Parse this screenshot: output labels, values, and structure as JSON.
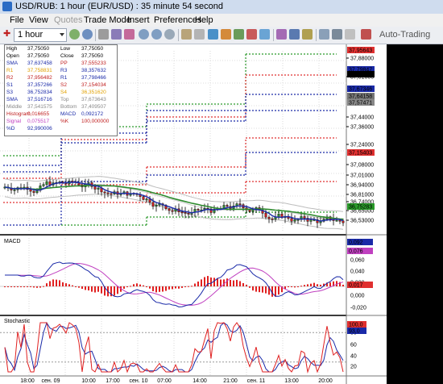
{
  "window": {
    "title": "USD/RUB: 1 hour (EUR/USD) : 35 minute 54 second"
  },
  "menu": [
    {
      "label": "File",
      "disabled": false
    },
    {
      "label": "View",
      "disabled": false
    },
    {
      "label": "Quotes",
      "disabled": true
    },
    {
      "label": "Trade Mode",
      "disabled": false
    },
    {
      "label": "Insert",
      "disabled": false
    },
    {
      "label": "Preferences",
      "disabled": false
    },
    {
      "label": "Help",
      "disabled": false
    }
  ],
  "toolbar": {
    "timeframe": "1 hour",
    "auto_trading": "Auto-Trading"
  },
  "info": {
    "rows": [
      [
        {
          "k": "High",
          "v": "37,75050",
          "c": "#000"
        },
        {
          "k": "Low",
          "v": "37,75050",
          "c": "#000"
        }
      ],
      [
        {
          "k": "Open",
          "v": "37,75050",
          "c": "#000"
        },
        {
          "k": "Close",
          "v": "37,75050",
          "c": "#000"
        }
      ],
      [
        {
          "k": "SMA",
          "v": "37,637458",
          "c": "#1a2aa8"
        },
        {
          "k": "PP",
          "v": "37,555233",
          "c": "#c02020"
        }
      ],
      [
        {
          "k": "R1",
          "v": "37,758831",
          "c": "#e0a000"
        },
        {
          "k": "R3",
          "v": "38,357632",
          "c": "#1a2aa8"
        }
      ],
      [
        {
          "k": "R2",
          "v": "37,956482",
          "c": "#c02020"
        },
        {
          "k": "R1",
          "v": "37,798466",
          "c": "#1a2aa8"
        }
      ],
      [
        {
          "k": "S1",
          "v": "37,357266",
          "c": "#1a2aa8"
        },
        {
          "k": "S2",
          "v": "37,154034",
          "c": "#c02020"
        }
      ],
      [
        {
          "k": "S3",
          "v": "36,752834",
          "c": "#1a2aa8"
        },
        {
          "k": "S4",
          "v": "36,351620",
          "c": "#e0a000"
        }
      ],
      [
        {
          "k": "SMA",
          "v": "37,516716",
          "c": "#1a2aa8"
        },
        {
          "k": "Top",
          "v": "37,673643",
          "c": "#888"
        }
      ],
      [
        {
          "k": "Middle",
          "v": "37,541575",
          "c": "#888"
        },
        {
          "k": "Bottom",
          "v": "37,409507",
          "c": "#888"
        }
      ],
      [
        {
          "k": "Histogram",
          "v": "0,016655",
          "c": "#c02020"
        },
        {
          "k": "MACD",
          "v": "0,092172",
          "c": "#1a2aa8"
        }
      ],
      [
        {
          "k": "Signal",
          "v": "0,075517",
          "c": "#c040c0"
        },
        {
          "k": "%K",
          "v": "100,000000",
          "c": "#c02020"
        }
      ],
      [
        {
          "k": "%D",
          "v": "92,990006",
          "c": "#1a2aa8"
        }
      ]
    ]
  },
  "price_axis": {
    "ticks": [
      "37,88000",
      "37,81000",
      "37,44000",
      "37,36000",
      "37,24000",
      "37,08000",
      "37,01000",
      "36,94000",
      "36,81000",
      "36,74000",
      "36,65000",
      "36,53000"
    ],
    "tags": [
      {
        "label": "37,95643",
        "color": "#e03030"
      },
      {
        "label": "37,79847",
        "color": "#1a2aa8"
      },
      {
        "label": "37,75050",
        "color": "#000000"
      },
      {
        "label": "37,67346",
        "color": "#1a2aa8"
      },
      {
        "label": "37,64158",
        "color": "#777777"
      },
      {
        "label": "37,57471",
        "color": "#888888"
      },
      {
        "label": "37,15403",
        "color": "#e03030"
      },
      {
        "label": "36,75283",
        "color": "#2a9a2a"
      }
    ]
  },
  "macd": {
    "label": "MACD",
    "ticks": [
      "0,060",
      "0,040",
      "0,020",
      "0,000",
      "-0,020"
    ],
    "tags": [
      {
        "label": "0,092",
        "color": "#1a2aa8"
      },
      {
        "label": "0,076",
        "color": "#c040c0"
      },
      {
        "label": "0,017",
        "color": "#e03030"
      }
    ]
  },
  "stochastic": {
    "label": "Stochastic",
    "ticks": [
      "100,0",
      "80",
      "60",
      "40",
      "20"
    ],
    "tags": [
      {
        "label": "100,0",
        "color": "#e03030"
      },
      {
        "label": "93,0",
        "color": "#1a2aa8"
      }
    ]
  },
  "time_axis": [
    "18:00",
    "сен. 09",
    "10:00",
    "17:00",
    "сен. 10",
    "07:00",
    "14:00",
    "21:00",
    "сен. 11",
    "13:00",
    "20:00"
  ],
  "colors": {
    "bull": "#2e8b2e",
    "bear": "#c82020",
    "sma_blue": "#1a2aa8",
    "sma_green": "#2e8b2e"
  }
}
